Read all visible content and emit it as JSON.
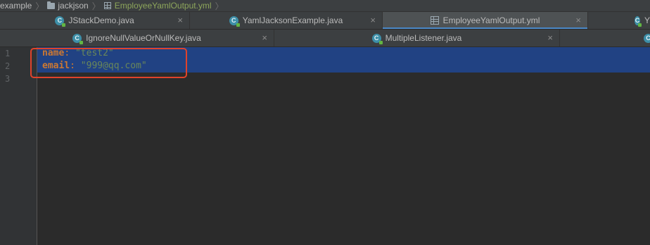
{
  "breadcrumb": {
    "items": [
      "example",
      "jackjson",
      "EmployeeYamlOutput.yml"
    ]
  },
  "tabs_row1": [
    {
      "label": "JStackDemo.java",
      "icon": "java-class-icon",
      "active": false
    },
    {
      "label": "YamlJacksonExample.java",
      "icon": "java-class-icon",
      "active": false
    },
    {
      "label": "EmployeeYamlOutput.yml",
      "icon": "yaml-file-icon",
      "active": true
    },
    {
      "label": "Y",
      "icon": "java-class-icon",
      "active": false
    }
  ],
  "tabs_row2": [
    {
      "label": "IgnoreNullValueOrNullKey.java",
      "icon": "java-class-icon",
      "active": false
    },
    {
      "label": "MultipleListener.java",
      "icon": "java-class-icon",
      "active": false
    },
    {
      "label": "",
      "icon": "java-class-icon",
      "active": false
    }
  ],
  "editor": {
    "line_numbers": [
      "1",
      "2",
      "3"
    ],
    "lines": [
      {
        "key": "name",
        "sep": ": ",
        "value": "\"test2\""
      },
      {
        "key": "email",
        "sep": ": ",
        "value": "\"999@qq.com\""
      }
    ]
  },
  "colors": {
    "background": "#2b2b2b",
    "selection": "#214283",
    "keyword": "#cc7832",
    "string": "#6a8759",
    "annotation_box": "#e0432b"
  }
}
